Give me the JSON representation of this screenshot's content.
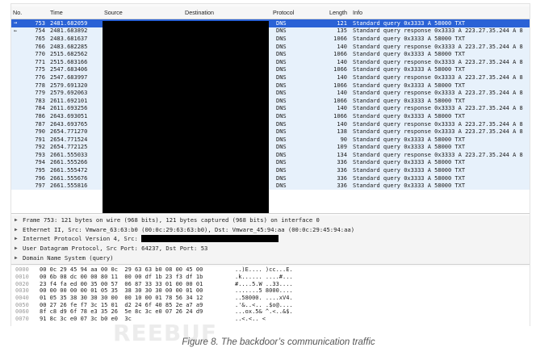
{
  "columns": {
    "no": "No.",
    "time": "Time",
    "source": "Source",
    "destination": "Destination",
    "protocol": "Protocol",
    "length": "Length",
    "info": "Info"
  },
  "packets": [
    {
      "no": "753",
      "time": "2481.682059",
      "proto": "DNS",
      "len": "121",
      "info": "Standard query 0x3333 A 58000 TXT",
      "selected": true,
      "mark": "→"
    },
    {
      "no": "754",
      "time": "2481.683892",
      "proto": "DNS",
      "len": "135",
      "info": "Standard query response 0x3333 A 223.27.35.244 A 8",
      "mark": "←"
    },
    {
      "no": "765",
      "time": "2483.681637",
      "proto": "DNS",
      "len": "1066",
      "info": "Standard query 0x3333 A 58000 TXT"
    },
    {
      "no": "766",
      "time": "2483.682285",
      "proto": "DNS",
      "len": "140",
      "info": "Standard query response 0x3333 A 223.27.35.244 A 8"
    },
    {
      "no": "770",
      "time": "2515.682562",
      "proto": "DNS",
      "len": "1066",
      "info": "Standard query 0x3333 A 58000 TXT"
    },
    {
      "no": "771",
      "time": "2515.683166",
      "proto": "DNS",
      "len": "140",
      "info": "Standard query response 0x3333 A 223.27.35.244 A 8"
    },
    {
      "no": "775",
      "time": "2547.683406",
      "proto": "DNS",
      "len": "1066",
      "info": "Standard query 0x3333 A 58000 TXT"
    },
    {
      "no": "776",
      "time": "2547.683997",
      "proto": "DNS",
      "len": "140",
      "info": "Standard query response 0x3333 A 223.27.35.244 A 8"
    },
    {
      "no": "778",
      "time": "2579.691320",
      "proto": "DNS",
      "len": "1066",
      "info": "Standard query 0x3333 A 58000 TXT"
    },
    {
      "no": "779",
      "time": "2579.692063",
      "proto": "DNS",
      "len": "140",
      "info": "Standard query response 0x3333 A 223.27.35.244 A 8"
    },
    {
      "no": "783",
      "time": "2611.692101",
      "proto": "DNS",
      "len": "1066",
      "info": "Standard query 0x3333 A 58000 TXT"
    },
    {
      "no": "784",
      "time": "2611.693256",
      "proto": "DNS",
      "len": "140",
      "info": "Standard query response 0x3333 A 223.27.35.244 A 8"
    },
    {
      "no": "786",
      "time": "2643.693051",
      "proto": "DNS",
      "len": "1066",
      "info": "Standard query 0x3333 A 58000 TXT"
    },
    {
      "no": "787",
      "time": "2643.693765",
      "proto": "DNS",
      "len": "140",
      "info": "Standard query response 0x3333 A 223.27.35.244 A 8"
    },
    {
      "no": "790",
      "time": "2654.771270",
      "proto": "DNS",
      "len": "138",
      "info": "Standard query response 0x3333 A 223.27.35.244 A 8"
    },
    {
      "no": "791",
      "time": "2654.771524",
      "proto": "DNS",
      "len": "90",
      "info": "Standard query 0x3333 A 58000 TXT"
    },
    {
      "no": "792",
      "time": "2654.772125",
      "proto": "DNS",
      "len": "109",
      "info": "Standard query 0x3333 A 58000 TXT"
    },
    {
      "no": "793",
      "time": "2661.555033",
      "proto": "DNS",
      "len": "134",
      "info": "Standard query response 0x3333 A 223.27.35.244 A 8"
    },
    {
      "no": "794",
      "time": "2661.555266",
      "proto": "DNS",
      "len": "336",
      "info": "Standard query 0x3333 A 58000 TXT"
    },
    {
      "no": "795",
      "time": "2661.555472",
      "proto": "DNS",
      "len": "336",
      "info": "Standard query 0x3333 A 58000 TXT"
    },
    {
      "no": "796",
      "time": "2661.555676",
      "proto": "DNS",
      "len": "336",
      "info": "Standard query 0x3333 A 58000 TXT"
    },
    {
      "no": "797",
      "time": "2661.555816",
      "proto": "DNS",
      "len": "336",
      "info": "Standard query 0x3333 A 58000 TXT"
    }
  ],
  "details": [
    "Frame 753: 121 bytes on wire (968 bits), 121 bytes captured (968 bits) on interface 0",
    "Ethernet II, Src: Vmware_63:63:b0 (00:0c:29:63:63:b0), Dst: Vmware_45:94:aa (00:0c:29:45:94:aa)",
    "Internet Protocol Version 4, Src:",
    "User Datagram Protocol, Src Port: 64237, Dst Port: 53",
    "Domain Name System (query)"
  ],
  "hex": [
    {
      "off": "0000",
      "bytes": "00 0c 29 45 94 aa 00 0c  29 63 63 b0 08 00 45 00",
      "ascii": "..)E.... )cc...E."
    },
    {
      "off": "0010",
      "bytes": "00 6b 08 dc 00 00 80 11  00 00 df 1b 23 f3 df 1b",
      "ascii": ".k...... ....#..."
    },
    {
      "off": "0020",
      "bytes": "23 f4 fa ed 00 35 00 57  06 87 33 33 01 00 00 01",
      "ascii": "#....5.W ..33...."
    },
    {
      "off": "0030",
      "bytes": "00 00 00 00 00 01 05 35  38 30 30 30 00 00 01 00",
      "ascii": ".......5 8000...."
    },
    {
      "off": "0040",
      "bytes": "01 05 35 38 30 30 30 00  00 10 00 01 78 56 34 12",
      "ascii": "..58000. ....xV4."
    },
    {
      "off": "0050",
      "bytes": "00 27 26 fe f7 3c 15 01  d2 24 6f 40 85 2e a7 a9",
      "ascii": ".'&..<.. .$o@...."
    },
    {
      "off": "0060",
      "bytes": "8f c8 d9 6f 78 e3 35 26  5e 8c 3c e0 07 26 24 d9",
      "ascii": "...ox.5& ^.<..&$."
    },
    {
      "off": "0070",
      "bytes": "91 8c 3c e0 07 3c b0 e0  3c",
      "ascii": "..<.<.. <"
    }
  ],
  "watermark": "REEBUF",
  "caption": "Figure 8. The backdoor’s communication traffic"
}
